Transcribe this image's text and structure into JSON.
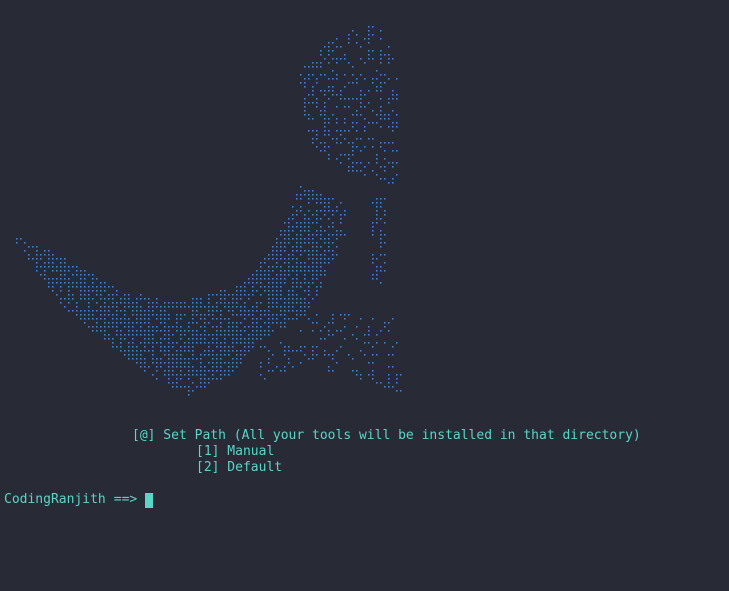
{
  "terminal": {
    "banner_icon": "ascii-art-bird",
    "menu": {
      "title": "[@] Set Path (All your tools will be installed in that directory)",
      "options": [
        "[1] Manual",
        "[2] Default"
      ]
    },
    "prompt": {
      "user": "CodingRanjith",
      "arrow": "==>"
    },
    "colors": {
      "background": "#282a36",
      "text": "#5ad6c7",
      "art": "#3e7fd6"
    }
  }
}
